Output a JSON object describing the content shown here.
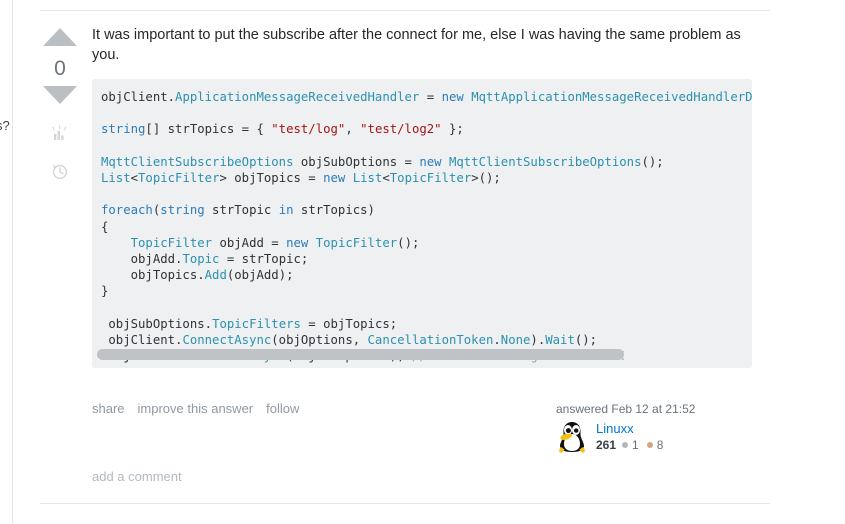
{
  "left_edge": {
    "clipped_text": "s?"
  },
  "vote": {
    "upvote_icon": "arrow-up-icon",
    "downvote_icon": "arrow-down-icon",
    "score": "0",
    "stats_icon": "bar-chart-icon",
    "history_icon": "clock-history-icon"
  },
  "answer": {
    "body_text": "It was important to put the subscribe after the connect for me, else I was having the same problem as you.",
    "code_lines": [
      [
        {
          "t": "objClient.",
          "c": "pun"
        },
        {
          "t": "ApplicationMessageReceivedHandler",
          "c": "typ"
        },
        {
          "t": " = ",
          "c": "pun"
        },
        {
          "t": "new",
          "c": "k"
        },
        {
          "t": " ",
          "c": "pun"
        },
        {
          "t": "MqttApplicationMessageReceivedHandlerDelegate",
          "c": "typ"
        },
        {
          "t": "(",
          "c": "pun"
        }
      ],
      [],
      [
        {
          "t": "string",
          "c": "k"
        },
        {
          "t": "[] strTopics = { ",
          "c": "pun"
        },
        {
          "t": "\"test/log\"",
          "c": "str"
        },
        {
          "t": ", ",
          "c": "pun"
        },
        {
          "t": "\"test/log2\"",
          "c": "str"
        },
        {
          "t": " };",
          "c": "pun"
        }
      ],
      [],
      [
        {
          "t": "MqttClientSubscribeOptions",
          "c": "typ"
        },
        {
          "t": " objSubOptions = ",
          "c": "pun"
        },
        {
          "t": "new",
          "c": "k"
        },
        {
          "t": " ",
          "c": "pun"
        },
        {
          "t": "MqttClientSubscribeOptions",
          "c": "typ"
        },
        {
          "t": "();",
          "c": "pun"
        }
      ],
      [
        {
          "t": "List",
          "c": "typ"
        },
        {
          "t": "<",
          "c": "pun"
        },
        {
          "t": "TopicFilter",
          "c": "typ"
        },
        {
          "t": "> objTopics = ",
          "c": "pun"
        },
        {
          "t": "new",
          "c": "k"
        },
        {
          "t": " ",
          "c": "pun"
        },
        {
          "t": "List",
          "c": "typ"
        },
        {
          "t": "<",
          "c": "pun"
        },
        {
          "t": "TopicFilter",
          "c": "typ"
        },
        {
          "t": ">();",
          "c": "pun"
        }
      ],
      [],
      [
        {
          "t": "foreach",
          "c": "k"
        },
        {
          "t": "(",
          "c": "pun"
        },
        {
          "t": "string",
          "c": "k"
        },
        {
          "t": " strTopic ",
          "c": "pun"
        },
        {
          "t": "in",
          "c": "k"
        },
        {
          "t": " strTopics)",
          "c": "pun"
        }
      ],
      [
        {
          "t": "{",
          "c": "pun"
        }
      ],
      [
        {
          "t": "    ",
          "c": "pun"
        },
        {
          "t": "TopicFilter",
          "c": "typ"
        },
        {
          "t": " objAdd = ",
          "c": "pun"
        },
        {
          "t": "new",
          "c": "k"
        },
        {
          "t": " ",
          "c": "pun"
        },
        {
          "t": "TopicFilter",
          "c": "typ"
        },
        {
          "t": "();",
          "c": "pun"
        }
      ],
      [
        {
          "t": "    objAdd.",
          "c": "pun"
        },
        {
          "t": "Topic",
          "c": "typ"
        },
        {
          "t": " = strTopic;",
          "c": "pun"
        }
      ],
      [
        {
          "t": "    objTopics.",
          "c": "pun"
        },
        {
          "t": "Add",
          "c": "typ"
        },
        {
          "t": "(objAdd);",
          "c": "pun"
        }
      ],
      [
        {
          "t": "}",
          "c": "pun"
        }
      ],
      [],
      [
        {
          "t": " objSubOptions.",
          "c": "pun"
        },
        {
          "t": "TopicFilters",
          "c": "typ"
        },
        {
          "t": " = objTopics;",
          "c": "pun"
        }
      ],
      [
        {
          "t": " objClient.",
          "c": "pun"
        },
        {
          "t": "ConnectAsync",
          "c": "typ"
        },
        {
          "t": "(objOptions, ",
          "c": "pun"
        },
        {
          "t": "CancellationToken",
          "c": "typ"
        },
        {
          "t": ".",
          "c": "pun"
        },
        {
          "t": "None",
          "c": "typ"
        },
        {
          "t": ").",
          "c": "pun"
        },
        {
          "t": "Wait",
          "c": "typ"
        },
        {
          "t": "();",
          "c": "pun"
        }
      ],
      [
        {
          "t": " objClient.",
          "c": "pun"
        },
        {
          "t": "SubscribeAsync",
          "c": "typ"
        },
        {
          "t": "(objSubOptions); ",
          "c": "pun"
        },
        {
          "t": "//!!!!subscribe goes here!!!!",
          "c": "cmt"
        }
      ]
    ],
    "actions": [
      {
        "label": "share",
        "name": "share-link"
      },
      {
        "label": "improve this answer",
        "name": "improve-answer-link"
      },
      {
        "label": "follow",
        "name": "follow-link"
      }
    ],
    "answered_text": "answered Feb 12 at 21:52",
    "user": {
      "name": "Linuxx",
      "reputation": "261",
      "silver_badges": "1",
      "bronze_badges": "8",
      "avatar_icon": "tux-penguin-avatar"
    },
    "add_comment_label": "add a comment"
  },
  "colors": {
    "code_bg": "#eff0f1",
    "link_blue": "#0077cc",
    "keyword_blue": "#2b7bb9",
    "type_blue": "#2b91af",
    "string_red": "#a31515",
    "comment_gray": "#9aa0a6",
    "silver_badge": "#b4b8bc",
    "bronze_badge": "#d1a684",
    "muted_text": "#6a737c"
  }
}
